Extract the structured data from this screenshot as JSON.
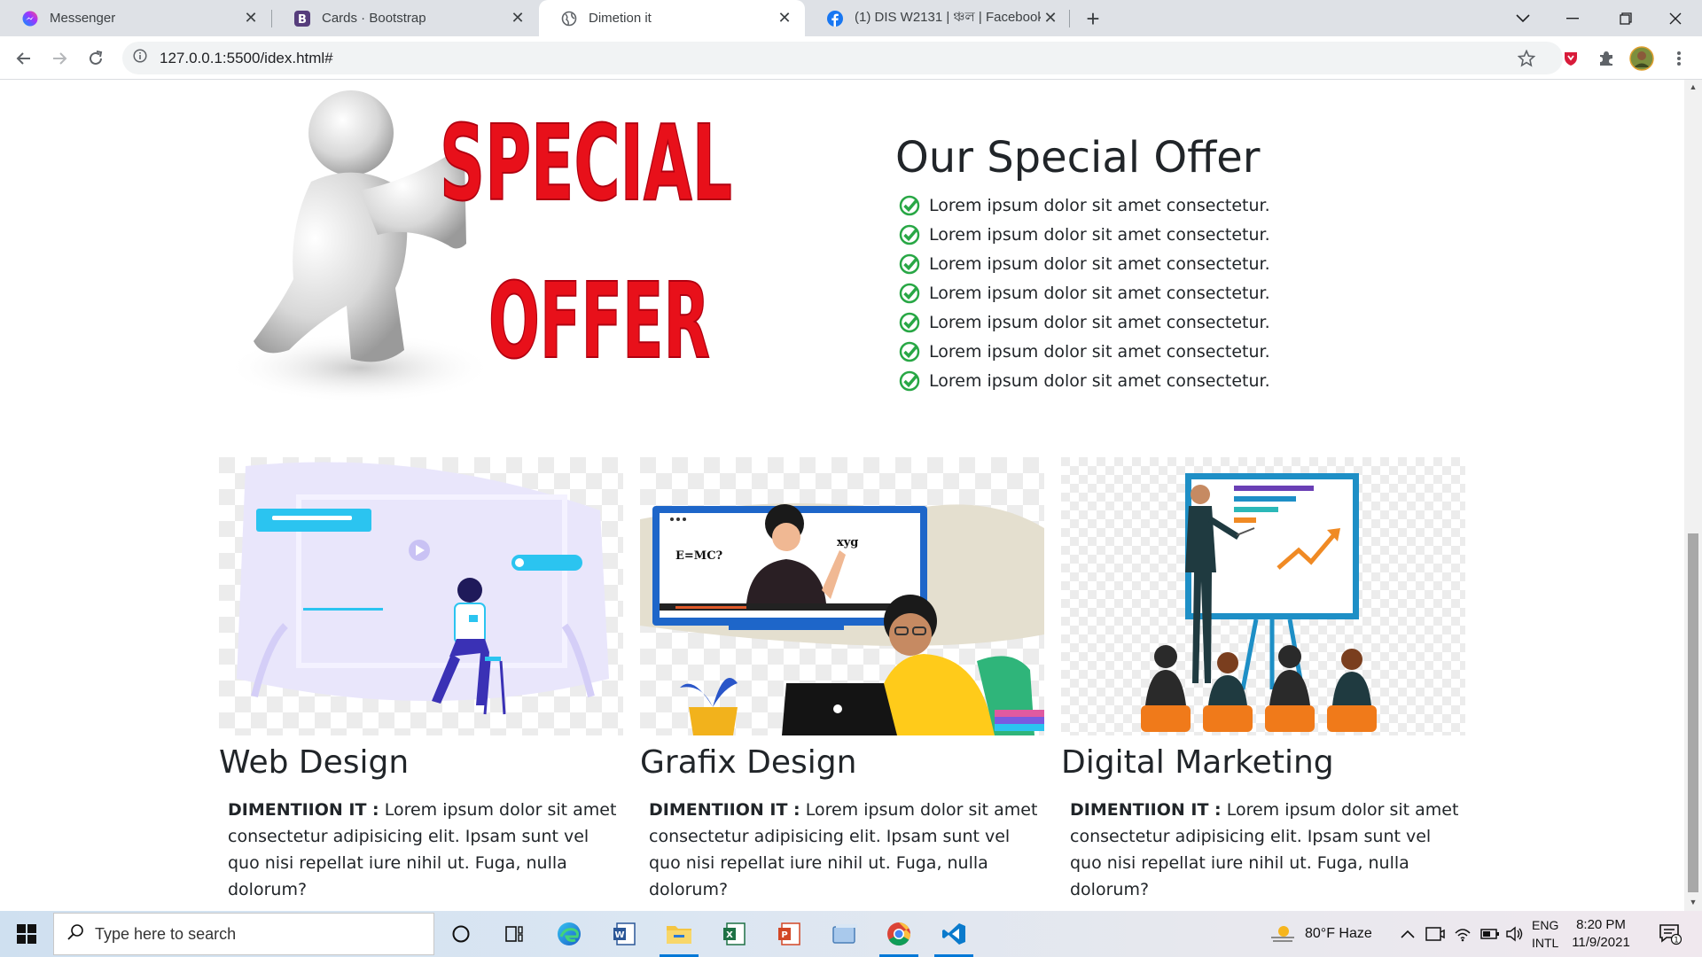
{
  "browser": {
    "tabs": [
      {
        "title": "Messenger",
        "icon": "messenger-icon"
      },
      {
        "title": "Cards · Bootstrap",
        "icon": "bootstrap-icon"
      },
      {
        "title": "Dimetion it",
        "icon": "globe-icon",
        "active": true
      },
      {
        "title": "(1) DIS W2131 | ঞ্চল | Facebook",
        "icon": "facebook-icon"
      }
    ],
    "url": "127.0.0.1:5500/idex.html#"
  },
  "offer": {
    "title": "Our Special Offer",
    "image_text_1": "SPECIAL",
    "image_text_2": "OFFER",
    "items": [
      "Lorem ipsum dolor sit amet consectetur.",
      "Lorem ipsum dolor sit amet consectetur.",
      "Lorem ipsum dolor sit amet consectetur.",
      "Lorem ipsum dolor sit amet consectetur.",
      "Lorem ipsum dolor sit amet consectetur.",
      "Lorem ipsum dolor sit amet consectetur.",
      "Lorem ipsum dolor sit amet consectetur."
    ]
  },
  "cards": [
    {
      "title": "Web Design",
      "brand": "DIMENTIION IT :",
      "text": "Lorem ipsum dolor sit amet consectetur adipisicing elit. Ipsam sunt vel quo nisi repellat iure nihil ut. Fuga, nulla dolorum?"
    },
    {
      "title": "Grafix Design",
      "brand": "DIMENTIION IT :",
      "text": "Lorem ipsum dolor sit amet consectetur adipisicing elit. Ipsam sunt vel quo nisi repellat iure nihil ut. Fuga, nulla dolorum?",
      "image_text_1": "E=MC?",
      "image_text_2": "xyg"
    },
    {
      "title": "Digital Marketing",
      "brand": "DIMENTIION IT :",
      "text": "Lorem ipsum dolor sit amet consectetur adipisicing elit. Ipsam sunt vel quo nisi repellat iure nihil ut. Fuga, nulla dolorum?"
    }
  ],
  "taskbar": {
    "search_placeholder": "Type here to search",
    "weather": "80°F  Haze",
    "lang_1": "ENG",
    "lang_2": "INTL",
    "time": "8:20 PM",
    "date": "11/9/2021",
    "notification_count": "1"
  },
  "colors": {
    "accent": "#0078d7",
    "check": "#28a745",
    "offer_red": "#e8101a"
  }
}
